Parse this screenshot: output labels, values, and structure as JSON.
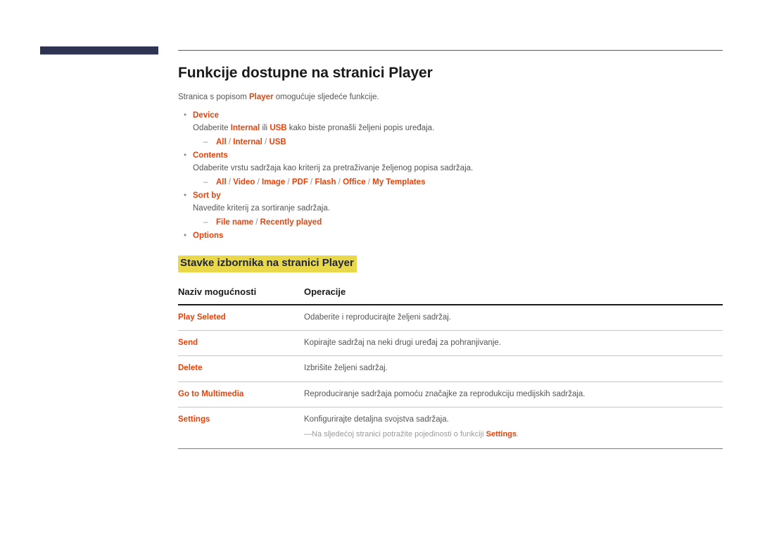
{
  "header": {
    "navy_bar": "decorative-navy-bar",
    "rule": "decorative-top-rule",
    "accent_navy": "#2e3352",
    "accent_orange": "#e8420a",
    "highlight_yellow": "#e8d84a"
  },
  "page": {
    "title": "Funkcije dostupne na stranici Player",
    "intro_before": "Stranica s popisom ",
    "intro_keyword": "Player",
    "intro_after": " omogućuje sljedeće funkcije."
  },
  "bullets": [
    {
      "label": "Device",
      "marker": "•",
      "desc_parts": [
        {
          "text": "Odaberite ",
          "kind": "plain"
        },
        {
          "text": "Internal",
          "kind": "kw"
        },
        {
          "text": " ili ",
          "kind": "plain"
        },
        {
          "text": "USB",
          "kind": "kw"
        },
        {
          "text": " kako biste pronašli željeni popis uređaja.",
          "kind": "plain"
        }
      ],
      "sub": {
        "marker": "–",
        "options": [
          "All",
          "Internal",
          "USB"
        ],
        "separator": " / "
      }
    },
    {
      "label": "Contents",
      "marker": "•",
      "desc_parts": [
        {
          "text": "Odaberite vrstu sadržaja kao kriterij za pretraživanje željenog popisa sadržaja.",
          "kind": "plain"
        }
      ],
      "sub": {
        "marker": "–",
        "options": [
          "All",
          "Video",
          "Image",
          "PDF",
          "Flash",
          "Office",
          "My Templates"
        ],
        "separator": " / "
      }
    },
    {
      "label": "Sort by",
      "marker": "•",
      "desc_parts": [
        {
          "text": "Navedite kriterij za sortiranje sadržaja.",
          "kind": "plain"
        }
      ],
      "sub": {
        "marker": "–",
        "options": [
          "File name",
          "Recently played"
        ],
        "separator": " / "
      }
    },
    {
      "label": "Options",
      "marker": "•",
      "desc_parts": [],
      "sub": null
    }
  ],
  "sub_heading": "Stavke izbornika na stranici Player",
  "table": {
    "headers": [
      "Naziv mogućnosti",
      "Operacije"
    ],
    "rows": [
      {
        "name": "Play Seleted",
        "operation": "Odaberite i reproducirajte željeni sadržaj.",
        "note": null
      },
      {
        "name": "Send",
        "operation": "Kopirajte sadržaj na neki drugi uređaj za pohranjivanje.",
        "note": null
      },
      {
        "name": "Delete",
        "operation": "Izbrišite željeni sadržaj.",
        "note": null
      },
      {
        "name": "Go to Multimedia",
        "operation": "Reproduciranje sadržaja pomoću značajke za reprodukciju medijskih sadržaja.",
        "note": null
      },
      {
        "name": "Settings",
        "operation": "Konfigurirajte detaljna svojstva sadržaja.",
        "note": {
          "marker": "—",
          "before": "Na sljedećoj stranici potražite pojedinosti o funkciji ",
          "keyword": "Settings",
          "after": "."
        }
      }
    ]
  }
}
